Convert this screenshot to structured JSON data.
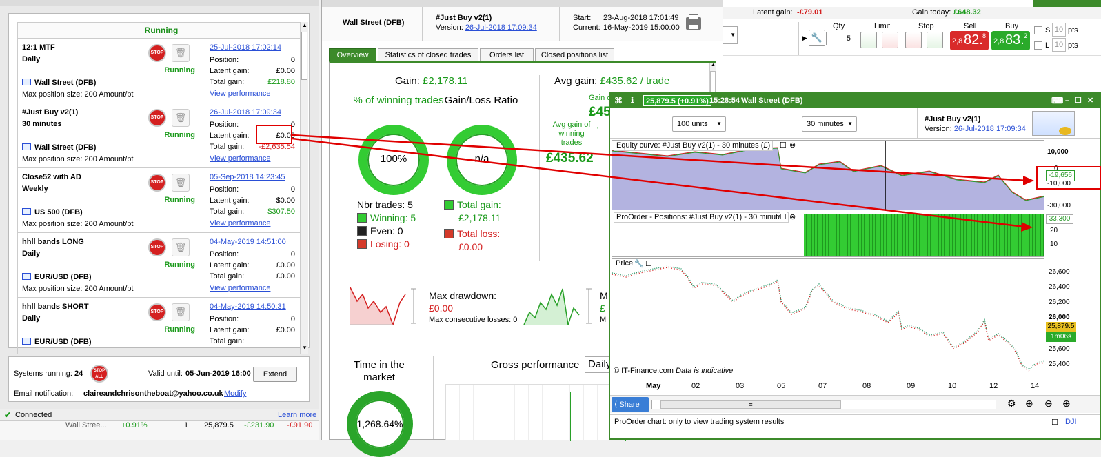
{
  "left_panel": {
    "header": "Running",
    "systems": [
      {
        "name": "12:1 MTF",
        "timeframe": "Daily",
        "status": "Running",
        "instrument": "Wall Street (DFB)",
        "max_position": "Max position size: 200 Amount/pt",
        "date": "25-Jul-2018 17:02:14",
        "position_label": "Position:",
        "position": "0",
        "latent_label": "Latent gain:",
        "latent": "£0.00",
        "total_label": "Total gain:",
        "total": "£218.80",
        "total_color": "green",
        "view": "View performance"
      },
      {
        "name": "#Just Buy v2(1)",
        "timeframe": "30 minutes",
        "status": "Running",
        "instrument": "Wall Street (DFB)",
        "max_position": "Max position size: 200 Amount/pt",
        "date": "26-Jul-2018 17:09:34",
        "position_label": "Position:",
        "position": "0",
        "latent_label": "Latent gain:",
        "latent": "£0.00",
        "total_label": "Total gain:",
        "total": "-£2,635.54",
        "total_color": "red",
        "view": "View performance"
      },
      {
        "name": "Close52 with AD",
        "timeframe": "Weekly",
        "status": "Running",
        "instrument": "US 500 (DFB)",
        "max_position": "Max position size: 200 Amount/pt",
        "date": "05-Sep-2018 14:23:45",
        "position_label": "Position:",
        "position": "0",
        "latent_label": "Latent gain:",
        "latent": "$0.00",
        "total_label": "Total gain:",
        "total": "$307.50",
        "total_color": "green",
        "view": "View performance"
      },
      {
        "name": "hhll bands LONG",
        "timeframe": "Daily",
        "status": "Running",
        "instrument": "EUR/USD (DFB)",
        "max_position": "Max position size: 200 Amount/pt",
        "date": "04-May-2019 14:51:00",
        "position_label": "Position:",
        "position": "0",
        "latent_label": "Latent gain:",
        "latent": "£0.00",
        "total_label": "Total gain:",
        "total": "£0.00",
        "total_color": "black",
        "view": "View performance"
      },
      {
        "name": "hhll bands SHORT",
        "timeframe": "Daily",
        "status": "Running",
        "instrument": "EUR/USD (DFB)",
        "max_position": "",
        "date": "04-May-2019 14:50:31",
        "position_label": "Position:",
        "position": "0",
        "latent_label": "Latent gain:",
        "latent": "£0.00",
        "total_label": "Total gain:",
        "total": "",
        "total_color": "black",
        "view": ""
      }
    ],
    "stop_label": "STOP",
    "systems_running_label": "Systems running:",
    "systems_running": "24",
    "stop_all_label": "STOP ALL",
    "valid_until_label": "Valid until:",
    "valid_until": "05-Jun-2019 16:00",
    "extend": "Extend",
    "email_label": "Email notification:",
    "email": "claireandchrisontheboat@yahoo.co.uk",
    "modify": "Modify",
    "connected": "Connected",
    "learn_more": "Learn more",
    "bottom_row": {
      "name": "Wall Stree...",
      "pct": "+0.91%",
      "qty": "1",
      "price": "25,879.5",
      "gain": "-£231.90",
      "gain2": "-£91.90"
    }
  },
  "report": {
    "instrument": "Wall Street (DFB)",
    "system_name": "#Just Buy v2(1)",
    "version_label": "Version:",
    "version": "26-Jul-2018 17:09:34",
    "start_label": "Start:",
    "start": "23-Aug-2018 17:01:49",
    "current_label": "Current:",
    "current": "16-May-2019 15:00:00",
    "tabs": [
      "Overview",
      "Statistics of closed trades",
      "Orders list",
      "Closed positions list"
    ],
    "gain_label": "Gain:",
    "gain": "£2,178.11",
    "pct_winning_label": "% of winning trades",
    "pct_winning": "100%",
    "gl_ratio_label": "Gain/Loss Ratio",
    "gl_ratio": "n/a",
    "nbr_trades_label": "Nbr trades:",
    "nbr_trades": "5",
    "winning_label": "Winning:",
    "winning": "5",
    "even_label": "Even:",
    "even": "0",
    "losing_label": "Losing:",
    "losing": "0",
    "total_gain_label": "Total gain:",
    "total_gain": "£2,178.11",
    "total_loss_label": "Total loss:",
    "total_loss": "£0.00",
    "avg_gain_label": "Avg gain:",
    "avg_gain": "£435.62 / trade",
    "avg_win_label": "Avg gain of winning trades",
    "avg_win": "£435.62",
    "gain_of_label": "Gain of",
    "gain_of_partial": "£45",
    "max_drawdown_label": "Max drawdown:",
    "max_drawdown": "£0.00",
    "max_consec_label": "Max consecutive losses:",
    "max_consec": "0",
    "time_in_market_label": "Time in the market",
    "time_in_market": "1,268.64%",
    "gross_perf_label": "Gross performance",
    "gross_perf_select": "Daily",
    "m_partial": "M",
    "pound_partial": "£",
    "m2_partial": "M"
  },
  "top_right": {
    "latent_label": "Latent gain:",
    "latent": "-£79.01",
    "today_label": "Gain today:",
    "today": "£648.32",
    "qty_label": "Qty",
    "qty": "5",
    "limit_label": "Limit",
    "stop_label": "Stop",
    "sell_label": "Sell",
    "sell_small": "2,8",
    "sell_big": "82.",
    "sell_sup": "8",
    "buy_label": "Buy",
    "buy_small": "2,8",
    "buy_big": "83.",
    "buy_sup": "2",
    "s_label": "S",
    "l_label": "L",
    "pts_value": "10",
    "pts_label": "pts"
  },
  "chart_window": {
    "price_change": "25,879.5 (+0.91%)",
    "time": "15:28:54",
    "instrument": "Wall Street (DFB)",
    "units": "100 units",
    "interval": "30 minutes",
    "system_name": "#Just Buy v2(1)",
    "version_label": "Version:",
    "version": "26-Jul-2018 17:09:34",
    "equity_label": "Equity curve: #Just Buy v2(1) - 30 minutes (£)",
    "positions_label": "ProOrder - Positions: #Just Buy v2(1) - 30 minutes",
    "price_label": "Price",
    "equity_axis": [
      "10,000",
      "0",
      "-10,000",
      "-19,656",
      "-30,000"
    ],
    "positions_axis": [
      "33.300",
      "20",
      "10"
    ],
    "price_axis": [
      "26,600",
      "26,400",
      "26,200",
      "26,000",
      "25,879.5",
      "1m06s",
      "25,600",
      "25,400"
    ],
    "x_axis": [
      "May",
      "02",
      "03",
      "05",
      "07",
      "08",
      "09",
      "10",
      "12",
      "14"
    ],
    "credit": "© IT-Finance.com",
    "indicative": "Data is indicative",
    "share": "Share",
    "footer": "ProOrder chart: only to view trading system results",
    "dji": "DJI",
    "colors": {
      "frame": "#3c8a2a",
      "equity_fill": "#b3b3e0",
      "positions": "#33cc33",
      "candle_up": "#2a9a6a",
      "candle_down": "#d42020",
      "annotation": "#e00000"
    }
  }
}
